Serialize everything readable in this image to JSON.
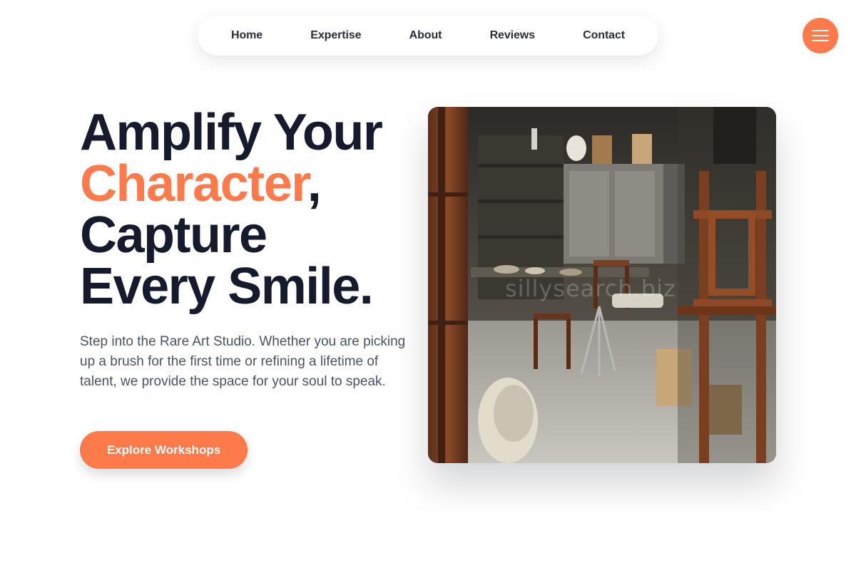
{
  "nav": {
    "items": [
      {
        "label": "Home"
      },
      {
        "label": "Expertise"
      },
      {
        "label": "About"
      },
      {
        "label": "Reviews"
      },
      {
        "label": "Contact"
      }
    ],
    "menu_icon": "hamburger-menu-icon"
  },
  "hero": {
    "title_line1": "Amplify Your",
    "title_accent": "Character",
    "title_comma": ",",
    "title_line3": "Capture",
    "title_line4": "Every Smile.",
    "description": "Step into the Rare Art Studio. Whether you are picking up a brush for the first time or refining a lifetime of talent, we provide the space for your soul to speak.",
    "cta_label": "Explore Workshops",
    "image_watermark": "sillysearch.biz"
  },
  "colors": {
    "accent": "#ff7a4a",
    "heading": "#151a2d",
    "body_text": "#4b5263"
  }
}
